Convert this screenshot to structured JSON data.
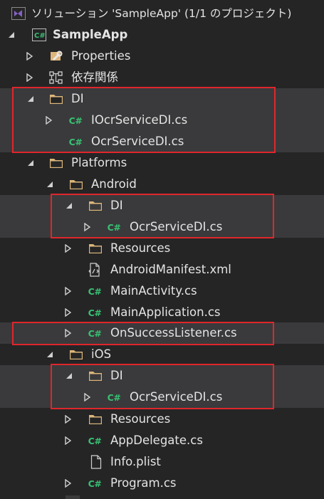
{
  "solution": {
    "title": "ソリューション 'SampleApp' (1/1 のプロジェクト)"
  },
  "nodes": [
    {
      "label": "SampleApp",
      "icon": "csharp-project-icon"
    },
    {
      "label": "Properties",
      "icon": "wrench-icon"
    },
    {
      "label": "依存関係",
      "icon": "dependencies-icon"
    },
    {
      "label": "DI",
      "icon": "folder-icon"
    },
    {
      "label": "IOcrServiceDI.cs",
      "icon": "csharp-file-icon"
    },
    {
      "label": "OcrServiceDI.cs",
      "icon": "csharp-file-icon"
    },
    {
      "label": "Platforms",
      "icon": "folder-icon"
    },
    {
      "label": "Android",
      "icon": "folder-icon"
    },
    {
      "label": "DI",
      "icon": "folder-icon"
    },
    {
      "label": "OcrServiceDI.cs",
      "icon": "csharp-file-icon"
    },
    {
      "label": "Resources",
      "icon": "folder-icon"
    },
    {
      "label": "AndroidManifest.xml",
      "icon": "xml-file-icon"
    },
    {
      "label": "MainActivity.cs",
      "icon": "csharp-file-icon"
    },
    {
      "label": "MainApplication.cs",
      "icon": "csharp-file-icon"
    },
    {
      "label": "OnSuccessListener.cs",
      "icon": "csharp-file-icon"
    },
    {
      "label": "iOS",
      "icon": "folder-icon"
    },
    {
      "label": "DI",
      "icon": "folder-icon"
    },
    {
      "label": "OcrServiceDI.cs",
      "icon": "csharp-file-icon"
    },
    {
      "label": "Resources",
      "icon": "folder-icon"
    },
    {
      "label": "AppDelegate.cs",
      "icon": "csharp-file-icon"
    },
    {
      "label": "Info.plist",
      "icon": "file-icon"
    },
    {
      "label": "Program.cs",
      "icon": "csharp-file-icon"
    }
  ],
  "csharp_badge": "C#",
  "colors": {
    "background": "#252526",
    "highlight_row": "#3a3a3c",
    "red_outline": "#e0262b",
    "folder": "#dcb67a",
    "csharp": "#38c172",
    "vs_purple": "#8561c5"
  }
}
